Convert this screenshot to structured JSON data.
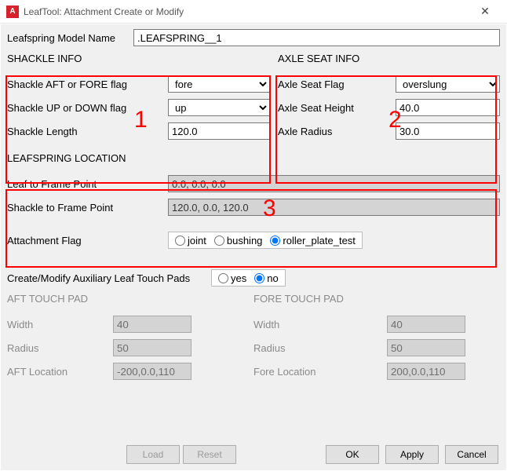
{
  "title": "LeafTool: Attachment Create or Modify",
  "modelName": {
    "label": "Leafspring Model Name",
    "value": ".LEAFSPRING__1"
  },
  "shackle": {
    "title": "SHACKLE INFO",
    "aftFore": {
      "label": "Shackle AFT or FORE flag",
      "value": "fore"
    },
    "upDown": {
      "label": "Shackle UP or DOWN flag",
      "value": "up"
    },
    "length": {
      "label": "Shackle Length",
      "value": "120.0"
    }
  },
  "axleSeat": {
    "title": "AXLE SEAT INFO",
    "flag": {
      "label": "Axle Seat Flag",
      "value": "overslung"
    },
    "height": {
      "label": "Axle Seat Height",
      "value": "40.0"
    },
    "radius": {
      "label": "Axle Radius",
      "value": "30.0"
    }
  },
  "location": {
    "title": "LEAFSPRING LOCATION",
    "leafToFrame": {
      "label": "Leaf to Frame Point",
      "value": "0.0, 0.0, 0.0"
    },
    "shackleToFrame": {
      "label": "Shackle to Frame Point",
      "value": "120.0, 0.0, 120.0"
    }
  },
  "attachmentFlag": {
    "label": "Attachment Flag",
    "options": [
      "joint",
      "bushing",
      "roller_plate_test"
    ],
    "selected": "roller_plate_test"
  },
  "touchPads": {
    "label": "Create/Modify Auxiliary Leaf Touch Pads",
    "options": [
      "yes",
      "no"
    ],
    "selected": "no"
  },
  "aftPad": {
    "title": "AFT TOUCH PAD",
    "width": {
      "label": "Width",
      "value": "40"
    },
    "radius": {
      "label": "Radius",
      "value": "50"
    },
    "location": {
      "label": "AFT Location",
      "value": "-200,0.0,110"
    }
  },
  "forePad": {
    "title": "FORE TOUCH PAD",
    "width": {
      "label": "Width",
      "value": "40"
    },
    "radius": {
      "label": "Radius",
      "value": "50"
    },
    "location": {
      "label": "Fore Location",
      "value": "200,0.0,110"
    }
  },
  "buttons": {
    "load": "Load",
    "reset": "Reset",
    "ok": "OK",
    "apply": "Apply",
    "cancel": "Cancel"
  },
  "annotations": {
    "n1": "1",
    "n2": "2",
    "n3": "3"
  }
}
